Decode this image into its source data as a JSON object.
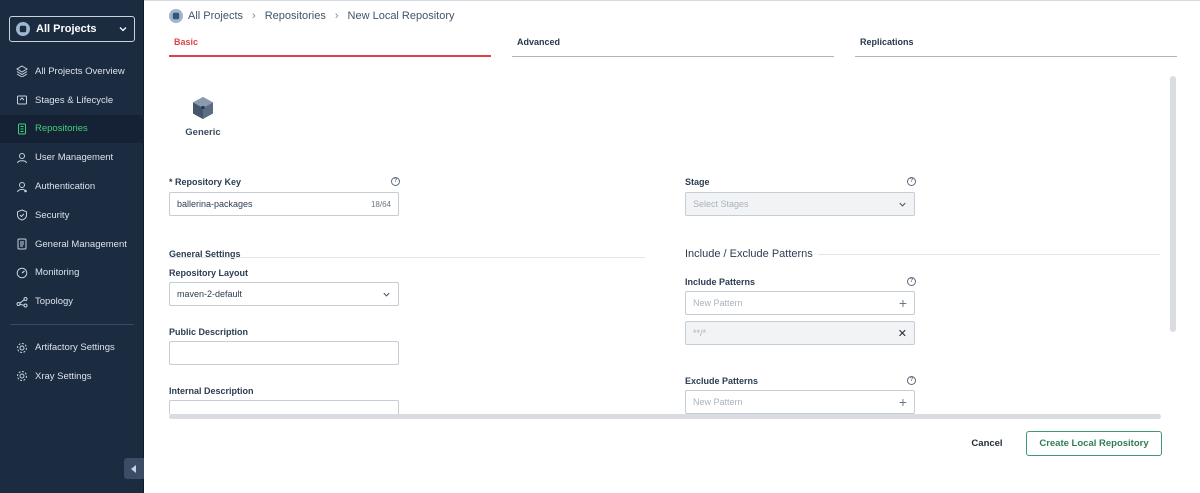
{
  "sidebar": {
    "project_selector": "All Projects",
    "items": [
      {
        "label": "All Projects Overview",
        "icon": "layers-icon"
      },
      {
        "label": "Stages & Lifecycle",
        "icon": "lifecycle-icon"
      },
      {
        "label": "Repositories",
        "icon": "repositories-icon",
        "active": true
      },
      {
        "label": "User Management",
        "icon": "user-icon"
      },
      {
        "label": "Authentication",
        "icon": "authentication-icon"
      },
      {
        "label": "Security",
        "icon": "shield-icon"
      },
      {
        "label": "General Management",
        "icon": "document-icon"
      },
      {
        "label": "Monitoring",
        "icon": "monitoring-icon"
      },
      {
        "label": "Topology",
        "icon": "topology-icon"
      }
    ],
    "secondary_items": [
      {
        "label": "Artifactory Settings",
        "icon": "settings-icon"
      },
      {
        "label": "Xray Settings",
        "icon": "settings-icon"
      }
    ]
  },
  "breadcrumb": {
    "root": "All Projects",
    "level1": "Repositories",
    "current": "New Local Repository"
  },
  "tabs": [
    {
      "label": "Basic",
      "active": true
    },
    {
      "label": "Advanced"
    },
    {
      "label": "Replications"
    }
  ],
  "package_type": {
    "label": "Generic",
    "icon": "generic-package-icon"
  },
  "repo_key": {
    "label": "* Repository Key",
    "value": "ballerina-packages",
    "counter": "18/64"
  },
  "stage": {
    "label": "Stage",
    "placeholder": "Select Stages"
  },
  "general_settings": {
    "title": "General Settings",
    "layout_label": "Repository Layout",
    "layout_value": "maven-2-default",
    "public_desc_label": "Public Description",
    "public_desc_value": "",
    "internal_desc_label": "Internal Description",
    "internal_desc_value": ""
  },
  "patterns": {
    "title": "Include / Exclude Patterns",
    "include_label": "Include Patterns",
    "include_placeholder": "New Pattern",
    "include_items": [
      "**/*"
    ],
    "exclude_label": "Exclude Patterns",
    "exclude_placeholder": "New Pattern"
  },
  "footer": {
    "cancel_label": "Cancel",
    "create_label": "Create Local Repository"
  },
  "colors": {
    "sidebar_bg": "#1b2b40",
    "active_nav": "#40d17a",
    "active_tab": "#e0424b",
    "create_btn": "#2f7d57"
  }
}
